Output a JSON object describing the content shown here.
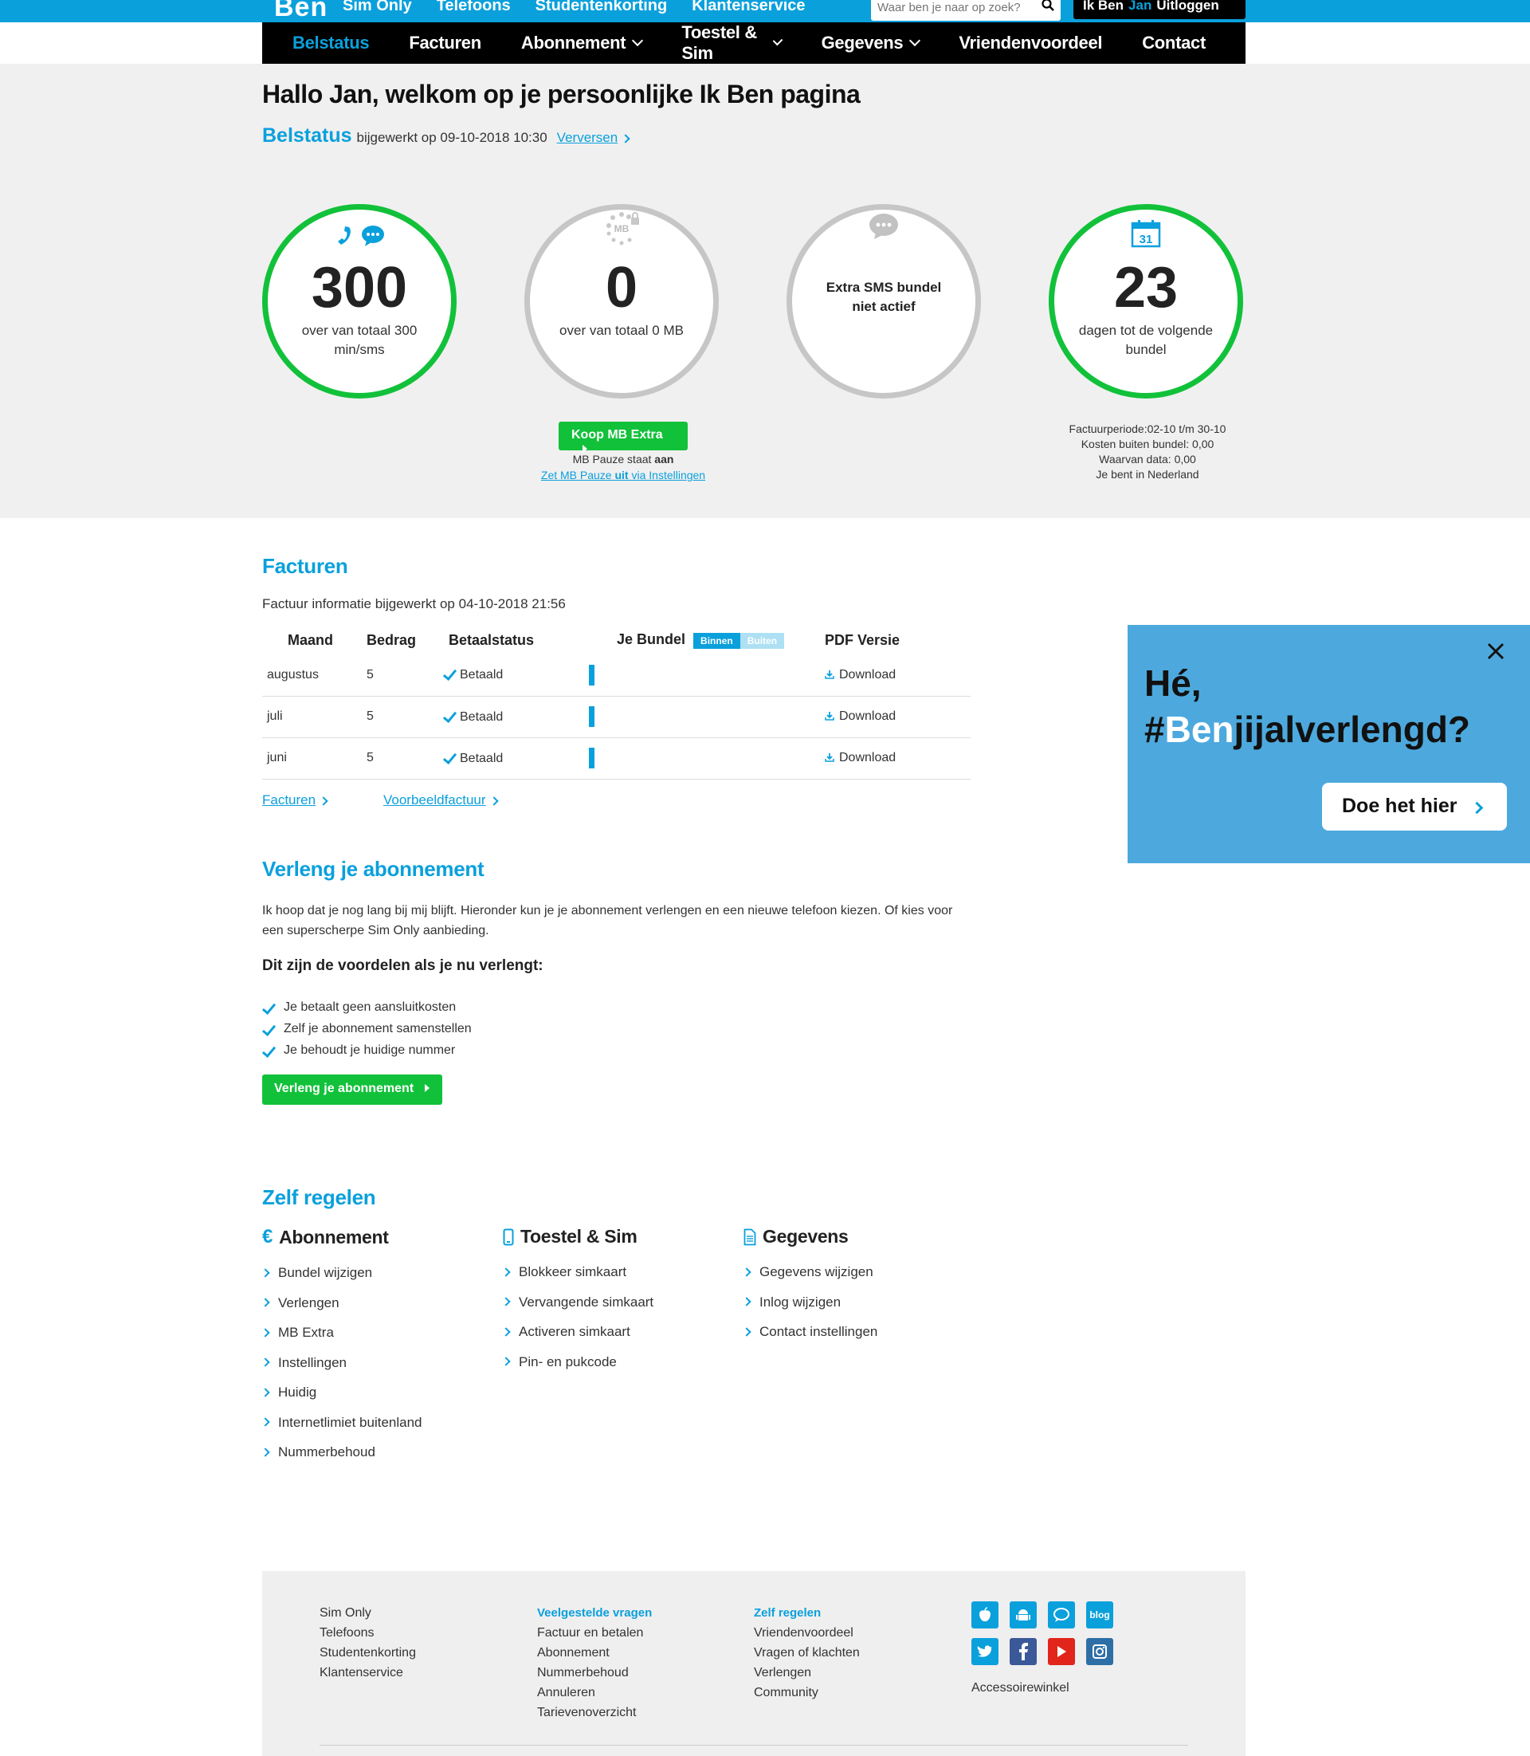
{
  "topbar": {
    "logo": "Ben",
    "nav": [
      "Sim Only",
      "Telefoons",
      "Studentenkorting",
      "Klantenservice"
    ],
    "search_placeholder": "Waar ben je naar op zoek?",
    "login_prefix": "Ik Ben",
    "login_name": "Jan",
    "logout": "Uitloggen"
  },
  "mainnav": {
    "items": [
      "Belstatus",
      "Facturen",
      "Abonnement",
      "Toestel & Sim",
      "Gegevens",
      "Vriendenvoordeel",
      "Contact"
    ]
  },
  "hero": {
    "greeting": "Hallo Jan, welkom op je persoonlijke Ik Ben pagina",
    "belstatus_label": "Belstatus",
    "updated": "bijgewerkt op 09-10-2018 10:30",
    "refresh": "Verversen",
    "circles": [
      {
        "value": "300",
        "label": "over van totaal 300 min/sms"
      },
      {
        "value": "0",
        "label": "over van totaal 0 MB",
        "icon_text": "MB"
      },
      {
        "label": "Extra SMS bundel niet actief"
      },
      {
        "value": "23",
        "label": "dagen tot de volgende bundel",
        "calendar_day": "31"
      }
    ],
    "buy_button": "Koop MB Extra",
    "mb_pause_prefix": "MB Pauze staat ",
    "mb_pause_state": "aan",
    "mb_pause_link_a": "Zet MB Pauze ",
    "mb_pause_link_b": "uit",
    "mb_pause_link_c": " via Instellingen",
    "factuur_info": [
      "Factuurperiode:02-10 t/m 30-10",
      "Kosten buiten bundel: 0,00",
      "Waarvan data: 0,00",
      "Je bent in Nederland"
    ]
  },
  "facturen": {
    "title": "Facturen",
    "updated": "Factuur informatie bijgewerkt op 04-10-2018 21:56",
    "headers": {
      "maand": "Maand",
      "bedrag": "Bedrag",
      "status": "Betaalstatus",
      "bundel": "Je Bundel",
      "binnen": "Binnen",
      "buiten": "Buiten",
      "pdf": "PDF Versie"
    },
    "rows": [
      {
        "maand": "augustus",
        "bedrag": "5",
        "status": "Betaald",
        "pdf": "Download"
      },
      {
        "maand": "juli",
        "bedrag": "5",
        "status": "Betaald",
        "pdf": "Download"
      },
      {
        "maand": "juni",
        "bedrag": "5",
        "status": "Betaald",
        "pdf": "Download"
      }
    ],
    "link_facturen": "Facturen",
    "link_voorbeeld": "Voorbeeldfactuur"
  },
  "verleng": {
    "title": "Verleng je abonnement",
    "text": "Ik hoop dat je nog lang bij mij blijft. Hieronder kun je je abonnement verlengen en een nieuwe telefoon kiezen. Of kies voor een superscherpe Sim Only aanbieding.",
    "voordelen_title": "Dit zijn de voordelen als je nu verlengt:",
    "voordelen": [
      "Je betaalt geen aansluitkosten",
      "Zelf je abonnement samenstellen",
      "Je behoudt je huidige nummer"
    ],
    "button": "Verleng je abonnement"
  },
  "zelf_regelen": {
    "title": "Zelf regelen",
    "columns": [
      {
        "title": "Abonnement",
        "icon_glyph": "€",
        "items": [
          "Bundel wijzigen",
          "Verlengen",
          "MB Extra",
          "Instellingen",
          "Huidig",
          "Internetlimiet buitenland",
          "Nummerbehoud"
        ]
      },
      {
        "title": "Toestel & Sim",
        "items": [
          "Blokkeer simkaart",
          "Vervangende simkaart",
          "Activeren simkaart",
          "Pin- en pukcode"
        ]
      },
      {
        "title": "Gegevens",
        "items": [
          "Gegevens wijzigen",
          "Inlog wijzigen",
          "Contact instellingen"
        ]
      }
    ]
  },
  "promo": {
    "line1": "Hé,",
    "hash": "#",
    "ben": "Ben",
    "rest": "jijalverlengd?",
    "cta": "Doe het hier"
  },
  "footer": {
    "col1": [
      "Sim Only",
      "Telefoons",
      "Studentenkorting",
      "Klantenservice"
    ],
    "col2_title": "Veelgestelde vragen",
    "col2": [
      "Factuur en betalen",
      "Abonnement",
      "Nummerbehoud",
      "Annuleren",
      "Tarievenoverzicht"
    ],
    "col3_title": "Zelf regelen",
    "col3": [
      "Vriendenvoordeel",
      "Vragen of klachten",
      "Verlengen",
      "Community"
    ],
    "blog_label": "blog",
    "accessoire": "Accessoirewinkel"
  },
  "colors": {
    "brand_blue": "#0aa0dc",
    "green": "#12c13a",
    "promo_bg": "#4da9dd"
  }
}
